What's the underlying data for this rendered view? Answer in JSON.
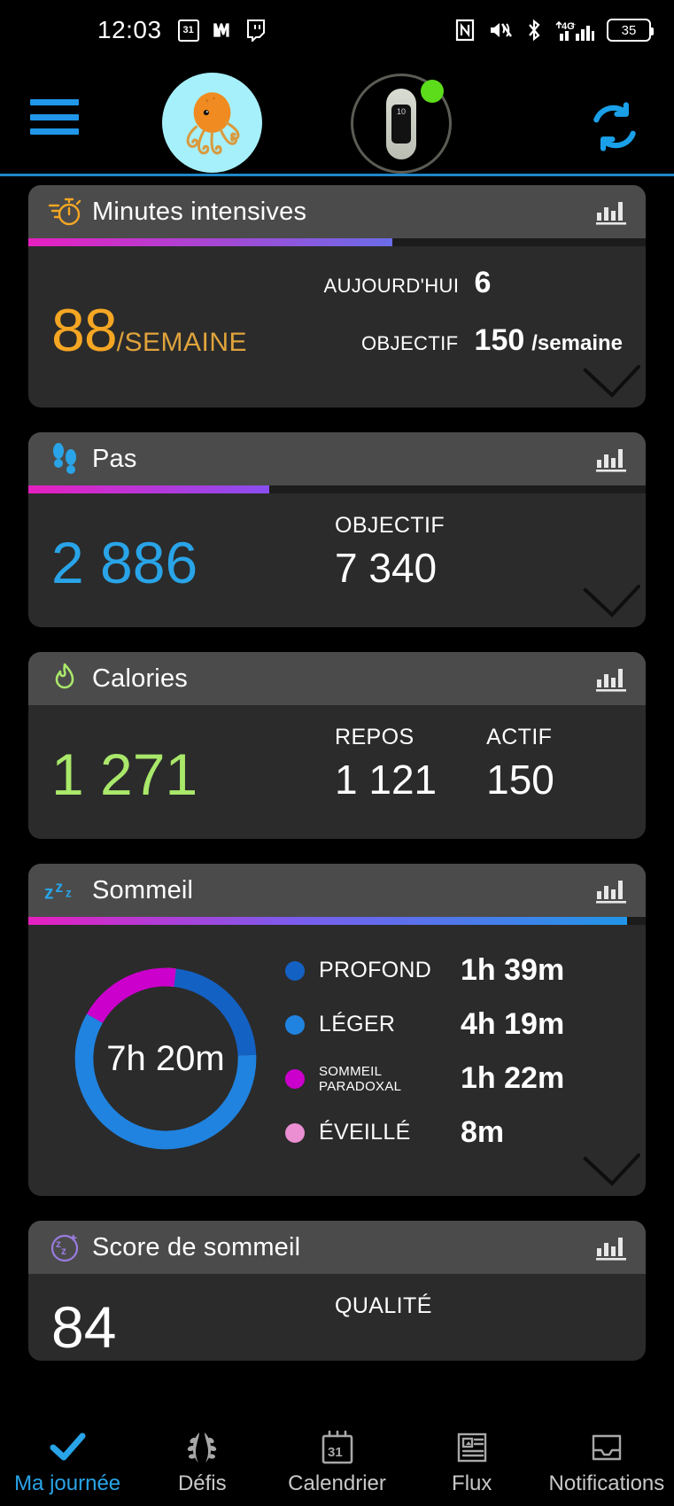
{
  "status_bar": {
    "time": "12:03",
    "left_icons": [
      "calendar-icon",
      "mastodon-icon",
      "twitch-icon"
    ],
    "calendar_day": "31",
    "right_icons": [
      "nfc-icon",
      "mute-icon",
      "bluetooth-icon",
      "signal-4g-icon"
    ],
    "battery_level": "35"
  },
  "app_bar": {
    "menu": "hamburger-menu-icon",
    "avatar": "octopus-avatar",
    "device": "fitness-band-device",
    "device_screen_value": "10",
    "device_status": "connected",
    "sync": "sync-icon"
  },
  "cards": {
    "intense_minutes": {
      "title": "Minutes intensives",
      "icon": "stopwatch-icon",
      "chart_icon": "bar-chart-icon",
      "progress_percent": 59,
      "value": "88",
      "unit": "/SEMAINE",
      "rows": [
        {
          "label": "AUJOURD'HUI",
          "value": "6",
          "suffix": ""
        },
        {
          "label": "OBJECTIF",
          "value": "150",
          "suffix": "/semaine"
        }
      ],
      "accent": "#f5a623"
    },
    "steps": {
      "title": "Pas",
      "icon": "footsteps-icon",
      "chart_icon": "bar-chart-icon",
      "progress_percent": 39,
      "value": "2 886",
      "goal_label": "OBJECTIF",
      "goal_value": "7 340",
      "accent": "#29a4e8"
    },
    "calories": {
      "title": "Calories",
      "icon": "flame-icon",
      "chart_icon": "bar-chart-icon",
      "value": "1 271",
      "columns": [
        {
          "label": "REPOS",
          "value": "1 121"
        },
        {
          "label": "ACTIF",
          "value": "150"
        }
      ],
      "accent": "#a9e86a"
    },
    "sleep": {
      "title": "Sommeil",
      "icon": "zzz-icon",
      "chart_icon": "bar-chart-icon",
      "progress_percent": 97,
      "total": "7h 20m",
      "legend": [
        {
          "label": "PROFOND",
          "value": "1h 39m",
          "color": "#1461c4"
        },
        {
          "label": "LÉGER",
          "value": "4h 19m",
          "color": "#2083e0"
        },
        {
          "label": "SOMMEIL PARADOXAL",
          "value": "1h 22m",
          "color": "#cc00cc",
          "small": true
        },
        {
          "label": "ÉVEILLÉ",
          "value": "8m",
          "color": "#eb8ed2"
        }
      ]
    },
    "sleep_score": {
      "title": "Score de sommeil",
      "icon": "moon-zz-icon",
      "chart_icon": "bar-chart-icon",
      "value": "84",
      "quality_label": "QUALITÉ",
      "accent": "#9a7ce0"
    }
  },
  "chart_data": {
    "type": "pie",
    "title": "Sommeil",
    "center_label": "7h 20m",
    "categories": [
      "PROFOND",
      "LÉGER",
      "SOMMEIL PARADOXAL",
      "ÉVEILLÉ"
    ],
    "values_minutes": [
      99,
      259,
      82,
      8
    ],
    "values_text": [
      "1h 39m",
      "4h 19m",
      "1h 22m",
      "8m"
    ],
    "colors": [
      "#1461c4",
      "#2083e0",
      "#cc00cc",
      "#eb8ed2"
    ],
    "total_minutes": 440,
    "legend": "right"
  },
  "nav": {
    "items": [
      {
        "label": "Ma journée",
        "icon": "checkmark-icon",
        "active": true
      },
      {
        "label": "Défis",
        "icon": "laurel-icon",
        "active": false
      },
      {
        "label": "Calendrier",
        "icon": "calendar-icon",
        "active": false,
        "day": "31"
      },
      {
        "label": "Flux",
        "icon": "newspaper-icon",
        "active": false
      },
      {
        "label": "Notifications",
        "icon": "inbox-icon",
        "active": false
      }
    ]
  },
  "colors": {
    "accent_blue": "#29a4e8",
    "card_bg": "#2b2b2b",
    "card_head_bg": "#4b4b4b",
    "background": "#000000"
  }
}
